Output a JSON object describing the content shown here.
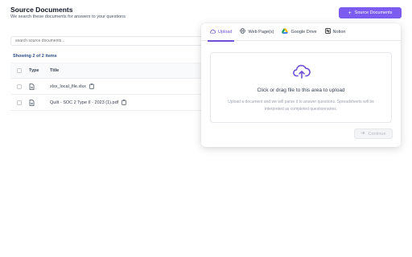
{
  "header": {
    "title": "Source Documents",
    "subtitle": "We search these documents for answers to your questions",
    "add_button_label": "Source Documents",
    "add_button_icon": "plus-icon"
  },
  "search": {
    "placeholder": "search source documents..."
  },
  "table": {
    "showing_text": "Showing 2 of 2 items",
    "columns": [
      "Type",
      "Title"
    ],
    "rows": [
      {
        "title": "xlsx_local_file.xlsx",
        "type_icon": "document-icon",
        "action_icon": "clipboard-icon"
      },
      {
        "title": "Quilt - SOC 2 Type II - 2023 (1).pdf",
        "type_icon": "document-icon",
        "action_icon": "clipboard-icon"
      }
    ]
  },
  "upload_panel": {
    "tabs": [
      {
        "label": "Upload",
        "icon": "cloud-icon",
        "active": true
      },
      {
        "label": "Web Page(s)",
        "icon": "globe-icon",
        "active": false
      },
      {
        "label": "Google Drive",
        "icon": "google-drive-icon",
        "active": false
      },
      {
        "label": "Notion",
        "icon": "notion-icon",
        "active": false
      }
    ],
    "drop_main": "Click or drag file to this area to upload",
    "drop_hint": "Upload a document and we will parse it to answer questions. Spreadsheets will be interpreted as completed questionnaires.",
    "continue_label": "Continue"
  },
  "colors": {
    "accent": "#7c5cf0",
    "heading_link": "#2b4f86"
  }
}
